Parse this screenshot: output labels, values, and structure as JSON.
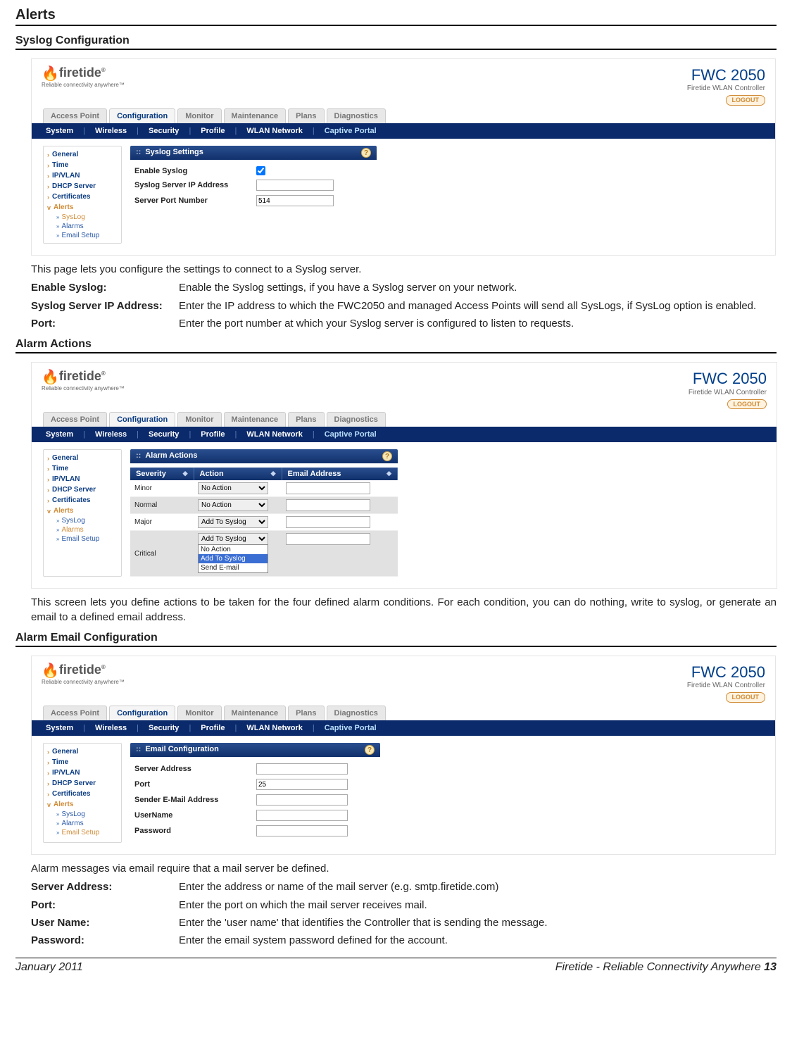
{
  "page": {
    "title": "Alerts"
  },
  "section1": {
    "title": "Syslog Configuration"
  },
  "section2": {
    "title": "Alarm Actions"
  },
  "section3": {
    "title": "Alarm Email Configuration"
  },
  "common": {
    "logo_name": "firetide",
    "logo_sub": "Reliable connectivity anywhere™",
    "product_name": "FWC 2050",
    "product_sub": "Firetide WLAN Controller",
    "logout": "LOGOUT",
    "main_tabs": [
      "Access Point",
      "Configuration",
      "Monitor",
      "Maintenance",
      "Plans",
      "Diagnostics"
    ],
    "sub_tabs": [
      "System",
      "Wireless",
      "Security",
      "Profile",
      "WLAN Network",
      "Captive Portal"
    ],
    "side": {
      "items": [
        "General",
        "Time",
        "IP/VLAN",
        "DHCP Server",
        "Certificates",
        "Alerts"
      ],
      "subs": [
        "SysLog",
        "Alarms",
        "Email Setup"
      ]
    },
    "help_glyph": "?"
  },
  "syslog": {
    "panel_title": "Syslog Settings",
    "label_enable": "Enable Syslog",
    "label_ip": "Syslog Server IP Address",
    "label_port": "Server Port Number",
    "port_value": "514",
    "desc_intro": "This page lets you configure the settings to connect to a Syslog server.",
    "def1_term": "Enable Syslog:",
    "def1_body": "Enable the Syslog settings, if you have a Syslog server on your network.",
    "def2_term": "Syslog Server IP Address:",
    "def2_body": "Enter the IP address to which the FWC2050 and managed Access Points will send all SysLogs, if SysLog option is enabled.",
    "def3_term": "Port:",
    "def3_body": "Enter the port number at which your Syslog server is configured to listen to requests."
  },
  "alarms": {
    "panel_title": "Alarm Actions",
    "col_sev": "Severity",
    "col_act": "Action",
    "col_email": "Email Address",
    "rows": [
      {
        "sev": "Minor",
        "act": "No Action"
      },
      {
        "sev": "Normal",
        "act": "No Action"
      },
      {
        "sev": "Major",
        "act": "Add To Syslog"
      },
      {
        "sev": "Critical",
        "act": "Add To Syslog"
      }
    ],
    "dropdown_opts": [
      "No Action",
      "Add To Syslog",
      "Send E-mail"
    ],
    "desc": "This screen lets you define actions to be taken for the four defined alarm conditions. For each condition, you can do nothing, write to syslog, or generate an email to a defined email address."
  },
  "email": {
    "panel_title": "Email Configuration",
    "label_server": "Server Address",
    "label_port": "Port",
    "port_value": "25",
    "label_sender": "Sender E-Mail Address",
    "label_user": "UserName",
    "label_pass": "Password",
    "desc_intro": "Alarm messages via email require that a mail server be defined.",
    "def1_term": "Server Address:",
    "def1_body": "Enter the address or name of the mail server (e.g. smtp.firetide.com)",
    "def2_term": "Port:",
    "def2_body": "Enter the port on which the mail server receives mail.",
    "def3_term": "User Name:",
    "def3_body": "Enter the 'user name' that identifies the Controller that is sending the message.",
    "def4_term": "Password:",
    "def4_body": "Enter the email system password defined for the account."
  },
  "footer": {
    "left": "January 2011",
    "right_text": "Firetide - Reliable Connectivity Anywhere ",
    "page_num": "13"
  }
}
